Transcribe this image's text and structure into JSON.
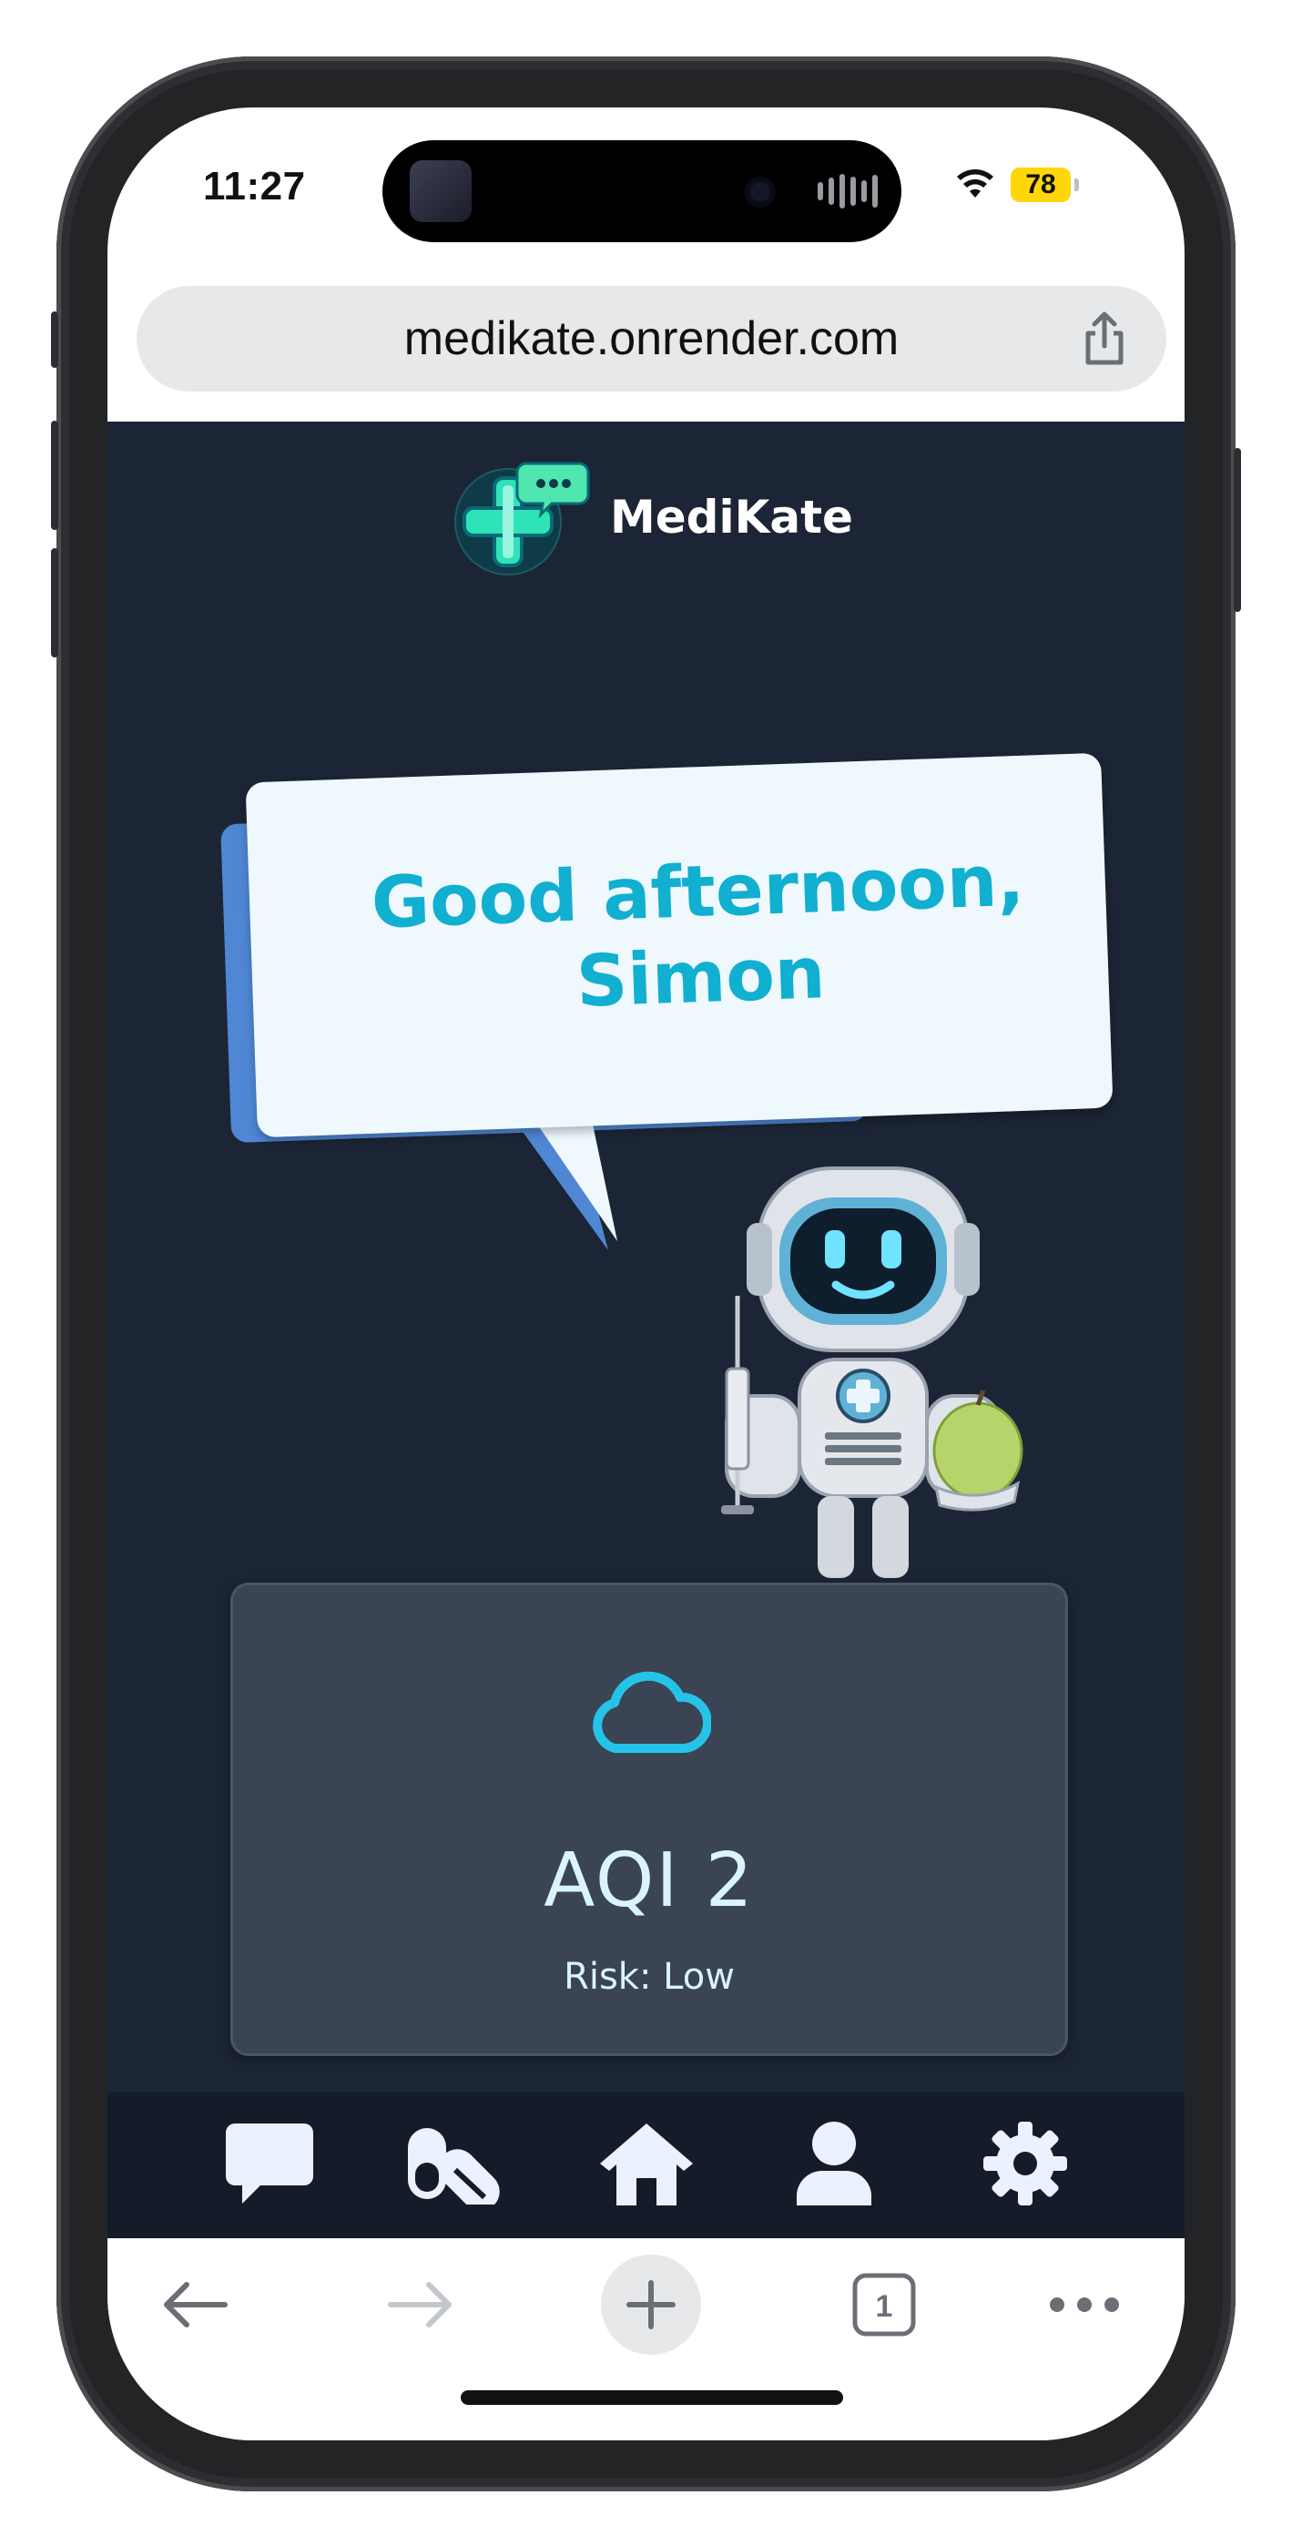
{
  "status_bar": {
    "time": "11:27",
    "battery": "78",
    "icons": [
      "wifi-icon",
      "battery-icon"
    ]
  },
  "browser": {
    "url": "medikate.onrender.com",
    "icons": [
      "share-icon",
      "back-arrow-icon",
      "forward-arrow-icon",
      "plus-icon",
      "tabs-icon",
      "more-icon"
    ],
    "tab_count": "1"
  },
  "app": {
    "brand_name": "MediKate",
    "greeting": "Good afternoon, Simon",
    "aqi": {
      "label": "AQI 2",
      "risk": "Risk: Low",
      "icon": "cloud-icon"
    },
    "nav": [
      "chat-icon",
      "pills-icon",
      "home-icon",
      "user-icon",
      "settings-icon"
    ]
  },
  "colors": {
    "background": "#1c2535",
    "accent": "#11afd0",
    "card": "#3a4454",
    "nav": "#141c2a"
  }
}
